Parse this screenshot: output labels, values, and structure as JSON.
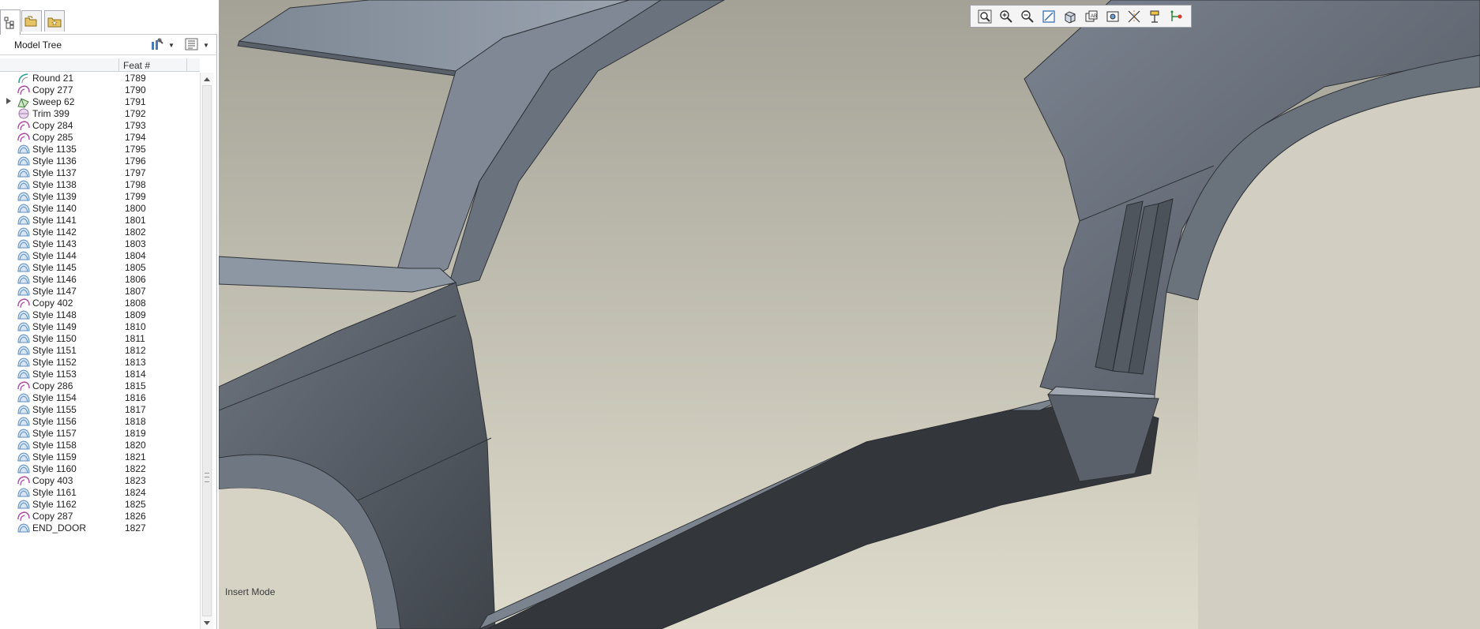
{
  "panel": {
    "tabs": [
      {
        "name": "model-tree-tab-icon"
      },
      {
        "name": "folder-browser-tab-icon"
      },
      {
        "name": "favorites-tab-icon"
      }
    ],
    "title": "Model Tree"
  },
  "columns": {
    "feat_num": "Feat #"
  },
  "tree": {
    "rows": [
      {
        "name": "Round 21",
        "num": "1789",
        "type": "round",
        "expandable": false
      },
      {
        "name": "Copy 277",
        "num": "1790",
        "type": "copy",
        "expandable": false
      },
      {
        "name": "Sweep 62",
        "num": "1791",
        "type": "sweep",
        "expandable": true
      },
      {
        "name": "Trim 399",
        "num": "1792",
        "type": "trim",
        "expandable": false
      },
      {
        "name": "Copy 284",
        "num": "1793",
        "type": "copy",
        "expandable": false
      },
      {
        "name": "Copy 285",
        "num": "1794",
        "type": "copy",
        "expandable": false
      },
      {
        "name": "Style 1135",
        "num": "1795",
        "type": "style",
        "expandable": false
      },
      {
        "name": "Style 1136",
        "num": "1796",
        "type": "style",
        "expandable": false
      },
      {
        "name": "Style 1137",
        "num": "1797",
        "type": "style",
        "expandable": false
      },
      {
        "name": "Style 1138",
        "num": "1798",
        "type": "style",
        "expandable": false
      },
      {
        "name": "Style 1139",
        "num": "1799",
        "type": "style",
        "expandable": false
      },
      {
        "name": "Style 1140",
        "num": "1800",
        "type": "style",
        "expandable": false
      },
      {
        "name": "Style 1141",
        "num": "1801",
        "type": "style",
        "expandable": false
      },
      {
        "name": "Style 1142",
        "num": "1802",
        "type": "style",
        "expandable": false
      },
      {
        "name": "Style 1143",
        "num": "1803",
        "type": "style",
        "expandable": false
      },
      {
        "name": "Style 1144",
        "num": "1804",
        "type": "style",
        "expandable": false
      },
      {
        "name": "Style 1145",
        "num": "1805",
        "type": "style",
        "expandable": false
      },
      {
        "name": "Style 1146",
        "num": "1806",
        "type": "style",
        "expandable": false
      },
      {
        "name": "Style 1147",
        "num": "1807",
        "type": "style",
        "expandable": false
      },
      {
        "name": "Copy 402",
        "num": "1808",
        "type": "copy",
        "expandable": false
      },
      {
        "name": "Style 1148",
        "num": "1809",
        "type": "style",
        "expandable": false
      },
      {
        "name": "Style 1149",
        "num": "1810",
        "type": "style",
        "expandable": false
      },
      {
        "name": "Style 1150",
        "num": "1811",
        "type": "style",
        "expandable": false
      },
      {
        "name": "Style 1151",
        "num": "1812",
        "type": "style",
        "expandable": false
      },
      {
        "name": "Style 1152",
        "num": "1813",
        "type": "style",
        "expandable": false
      },
      {
        "name": "Style 1153",
        "num": "1814",
        "type": "style",
        "expandable": false
      },
      {
        "name": "Copy 286",
        "num": "1815",
        "type": "copy",
        "expandable": false
      },
      {
        "name": "Style 1154",
        "num": "1816",
        "type": "style",
        "expandable": false
      },
      {
        "name": "Style 1155",
        "num": "1817",
        "type": "style",
        "expandable": false
      },
      {
        "name": "Style 1156",
        "num": "1818",
        "type": "style",
        "expandable": false
      },
      {
        "name": "Style 1157",
        "num": "1819",
        "type": "style",
        "expandable": false
      },
      {
        "name": "Style 1158",
        "num": "1820",
        "type": "style",
        "expandable": false
      },
      {
        "name": "Style 1159",
        "num": "1821",
        "type": "style",
        "expandable": false
      },
      {
        "name": "Style 1160",
        "num": "1822",
        "type": "style",
        "expandable": false
      },
      {
        "name": "Copy 403",
        "num": "1823",
        "type": "copy",
        "expandable": false
      },
      {
        "name": "Style 1161",
        "num": "1824",
        "type": "style",
        "expandable": false
      },
      {
        "name": "Style 1162",
        "num": "1825",
        "type": "style",
        "expandable": false
      },
      {
        "name": "Copy 287",
        "num": "1826",
        "type": "copy",
        "expandable": false
      },
      {
        "name": "END_DOOR",
        "num": "1827",
        "type": "style",
        "expandable": false
      }
    ]
  },
  "graphics": {
    "mode_text": "Insert Mode",
    "toolbar": [
      {
        "name": "zoom-fit-icon"
      },
      {
        "name": "zoom-in-icon"
      },
      {
        "name": "zoom-out-icon"
      },
      {
        "name": "repaint-icon"
      },
      {
        "name": "display-style-icon"
      },
      {
        "name": "saved-views-icon"
      },
      {
        "name": "view-manager-icon"
      },
      {
        "name": "datum-display-icon"
      },
      {
        "name": "annotation-display-icon"
      },
      {
        "name": "spin-center-icon"
      }
    ]
  },
  "colors": {
    "style_icon": "#5b8fc4",
    "copy_icon": "#b04aa8",
    "surface_light": "#8d96a3",
    "surface_dark": "#3a3e44",
    "background_top": "#a4a296",
    "background_bottom": "#dedbcc"
  }
}
